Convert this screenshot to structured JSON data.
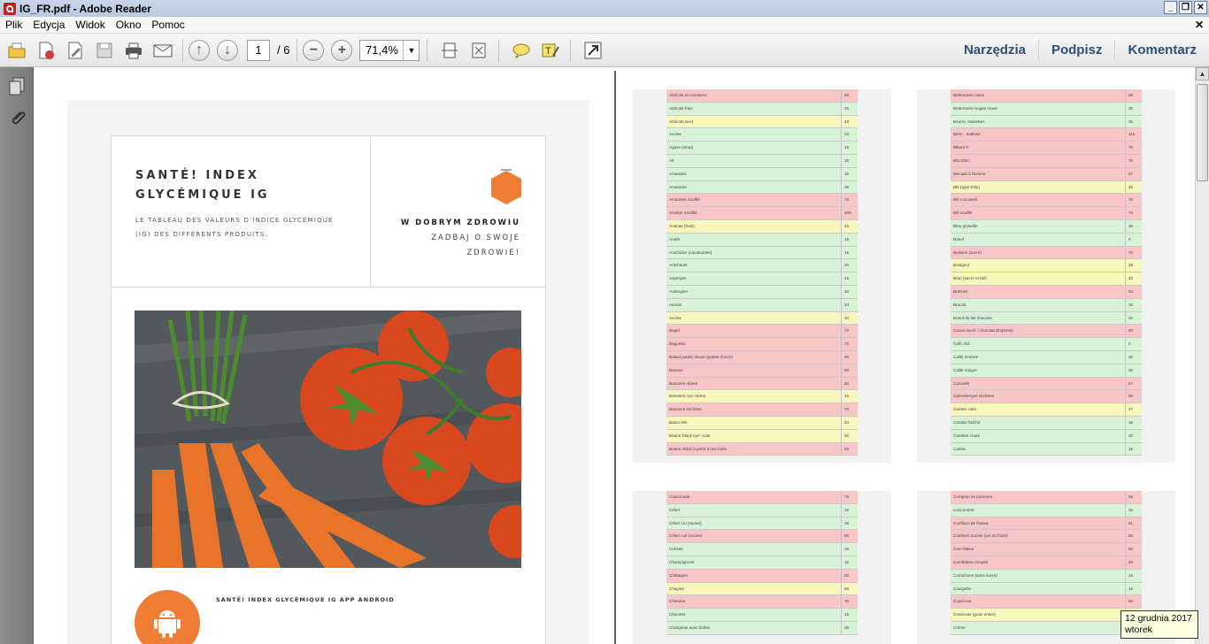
{
  "window": {
    "title": "IG_FR.pdf - Adobe Reader",
    "min": "_",
    "restore": "❐",
    "close": "✕"
  },
  "menu": {
    "items": [
      "Plik",
      "Edycja",
      "Widok",
      "Okno",
      "Pomoc"
    ],
    "close_doc": "✕"
  },
  "toolbar": {
    "page_current": "1",
    "page_total": "/ 6",
    "zoom": "71,4%",
    "tools_label": "Narzędzia",
    "sign_label": "Podpisz",
    "comment_label": "Komentarz"
  },
  "page1": {
    "title": "SANTÉ! INDEX GLYCÉMIQUE IG",
    "subtitle": "LE TABLEAU DES VALEURS D'INDICE GLYCÉMIQUE (IG) DES DIFFÉRENTS PRODUITS.",
    "slogan_bold": "W DOBRYM ZDROWIU",
    "slogan_line2": "ZADBAJ O SWOJE",
    "slogan_line3": "ZDROWIE!",
    "app_text": "SANTÉ! INDEX GLYCÉMIQUE IG APP ANDROID",
    "accent_color": "#ef7d33"
  },
  "tables": {
    "top_left": [
      [
        "Abricots en conserve",
        "60",
        "red"
      ],
      [
        "Abricots frais",
        "35",
        "grn"
      ],
      [
        "Abricots secs",
        "40",
        "yel"
      ],
      [
        "Avoine",
        "22",
        "grn"
      ],
      [
        "Agave (sirop)",
        "15",
        "grn"
      ],
      [
        "Ail",
        "30",
        "grn"
      ],
      [
        "Amandes",
        "15",
        "grn"
      ],
      [
        "Amarante",
        "35",
        "grn"
      ],
      [
        "Amarante soufflé",
        "70",
        "red"
      ],
      [
        "Amidon modifié",
        "100",
        "red"
      ],
      [
        "Ananas (frais)",
        "45",
        "yel"
      ],
      [
        "Aneth",
        "15",
        "grn"
      ],
      [
        "Arachides (cacahuètes)",
        "15",
        "grn"
      ],
      [
        "Artichauts",
        "20",
        "grn"
      ],
      [
        "Asperges",
        "15",
        "grn"
      ],
      [
        "Aubergine",
        "20",
        "grn"
      ],
      [
        "Avocat",
        "10",
        "grn"
      ],
      [
        "Avoine",
        "40",
        "yel"
      ],
      [
        "Bagel",
        "72",
        "red"
      ],
      [
        "Baguette",
        "70",
        "red"
      ],
      [
        "Baked patate douce (patate douce)",
        "90",
        "red"
      ],
      [
        "Banane",
        "60",
        "red"
      ],
      [
        "Bananes mûres",
        "60",
        "red"
      ],
      [
        "Bananes non mûres",
        "45",
        "yel"
      ],
      [
        "Bananes séchées",
        "70",
        "red"
      ],
      [
        "Baton tels",
        "44",
        "yel"
      ],
      [
        "Beans 'black eye' cuits",
        "40",
        "yel"
      ],
      [
        "Beans réduit à partir d'une boîte",
        "60",
        "red"
      ]
    ],
    "top_right": [
      [
        "Betteraves cuites",
        "65",
        "red"
      ],
      [
        "Betteraves rouges crues",
        "30",
        "grn"
      ],
      [
        "Beurre, Noisettes",
        "25",
        "grn"
      ],
      [
        "Bière - maltose",
        "110",
        "red"
      ],
      [
        "Biltard ®",
        "70",
        "red"
      ],
      [
        "Biscottes",
        "70",
        "red"
      ],
      [
        "Biscuits à l'avoine",
        "57",
        "red"
      ],
      [
        "Blé (type Ebly)",
        "45",
        "yel"
      ],
      [
        "Blé concassé",
        "70",
        "red"
      ],
      [
        "Blé soufflé",
        "74",
        "red"
      ],
      [
        "Bleu groseille",
        "25",
        "grn"
      ],
      [
        "Boeuf",
        "0",
        "grn"
      ],
      [
        "Boisson (sucré)",
        "70",
        "red"
      ],
      [
        "Boulgour",
        "48",
        "yel"
      ],
      [
        "Brun (sucre et blé)",
        "40",
        "yel"
      ],
      [
        "Bretzels",
        "83",
        "red"
      ],
      [
        "Brocoli",
        "15",
        "grn"
      ],
      [
        "Boeuf du lait d'avoine",
        "32",
        "grn"
      ],
      [
        "Cacao sucré / chocolat (Express)",
        "60",
        "red"
      ],
      [
        "Café, thé",
        "0",
        "grn"
      ],
      [
        "Caillé écrémé",
        "30",
        "grn"
      ],
      [
        "Caillé maigre",
        "30",
        "grn"
      ],
      [
        "Cannelle",
        "87",
        "red"
      ],
      [
        "Canneberges séchées",
        "65",
        "red"
      ],
      [
        "Carotte cuite",
        "47",
        "yel"
      ],
      [
        "Carotte fraîche",
        "16",
        "grn"
      ],
      [
        "Carottes crues",
        "30",
        "grn"
      ],
      [
        "Cassis",
        "15",
        "grn"
      ]
    ],
    "bottom_left": [
      [
        "Cassonade",
        "70",
        "red"
      ],
      [
        "Céleri",
        "15",
        "grn"
      ],
      [
        "Céleri cru (racine)",
        "35",
        "grn"
      ],
      [
        "Céleri cuit (racine)",
        "85",
        "red"
      ],
      [
        "Cerises",
        "25",
        "grn"
      ],
      [
        "Champignons",
        "15",
        "grn"
      ],
      [
        "Châtaigne",
        "60",
        "red"
      ],
      [
        "Chayote",
        "65",
        "yel"
      ],
      [
        "Chesdus",
        "70",
        "red"
      ],
      [
        "Chicorée",
        "15",
        "grn"
      ],
      [
        "Chickpeas avec boîtes",
        "38",
        "grn"
      ]
    ],
    "bottom_right": [
      [
        "Compote de pommes",
        "55",
        "red"
      ],
      [
        "Concombre",
        "15",
        "grn"
      ],
      [
        "Confiture de fraises",
        "51",
        "red"
      ],
      [
        "Confiture sucrée (jus de fruits)",
        "50",
        "red"
      ],
      [
        "Corn flakes",
        "80",
        "red"
      ],
      [
        "Cornflakes complet",
        "68",
        "red"
      ],
      [
        "Cornichons (sans sucre)",
        "15",
        "grn"
      ],
      [
        "Courgette",
        "15",
        "grn"
      ],
      [
        "Couscous",
        "65",
        "red"
      ],
      [
        "Couscous (grain entier)",
        "50",
        "yel"
      ],
      [
        "Crème",
        "30",
        "grn"
      ]
    ]
  },
  "tooltip": {
    "line1": "12 grudnia 2017",
    "line2": "wtorek"
  }
}
